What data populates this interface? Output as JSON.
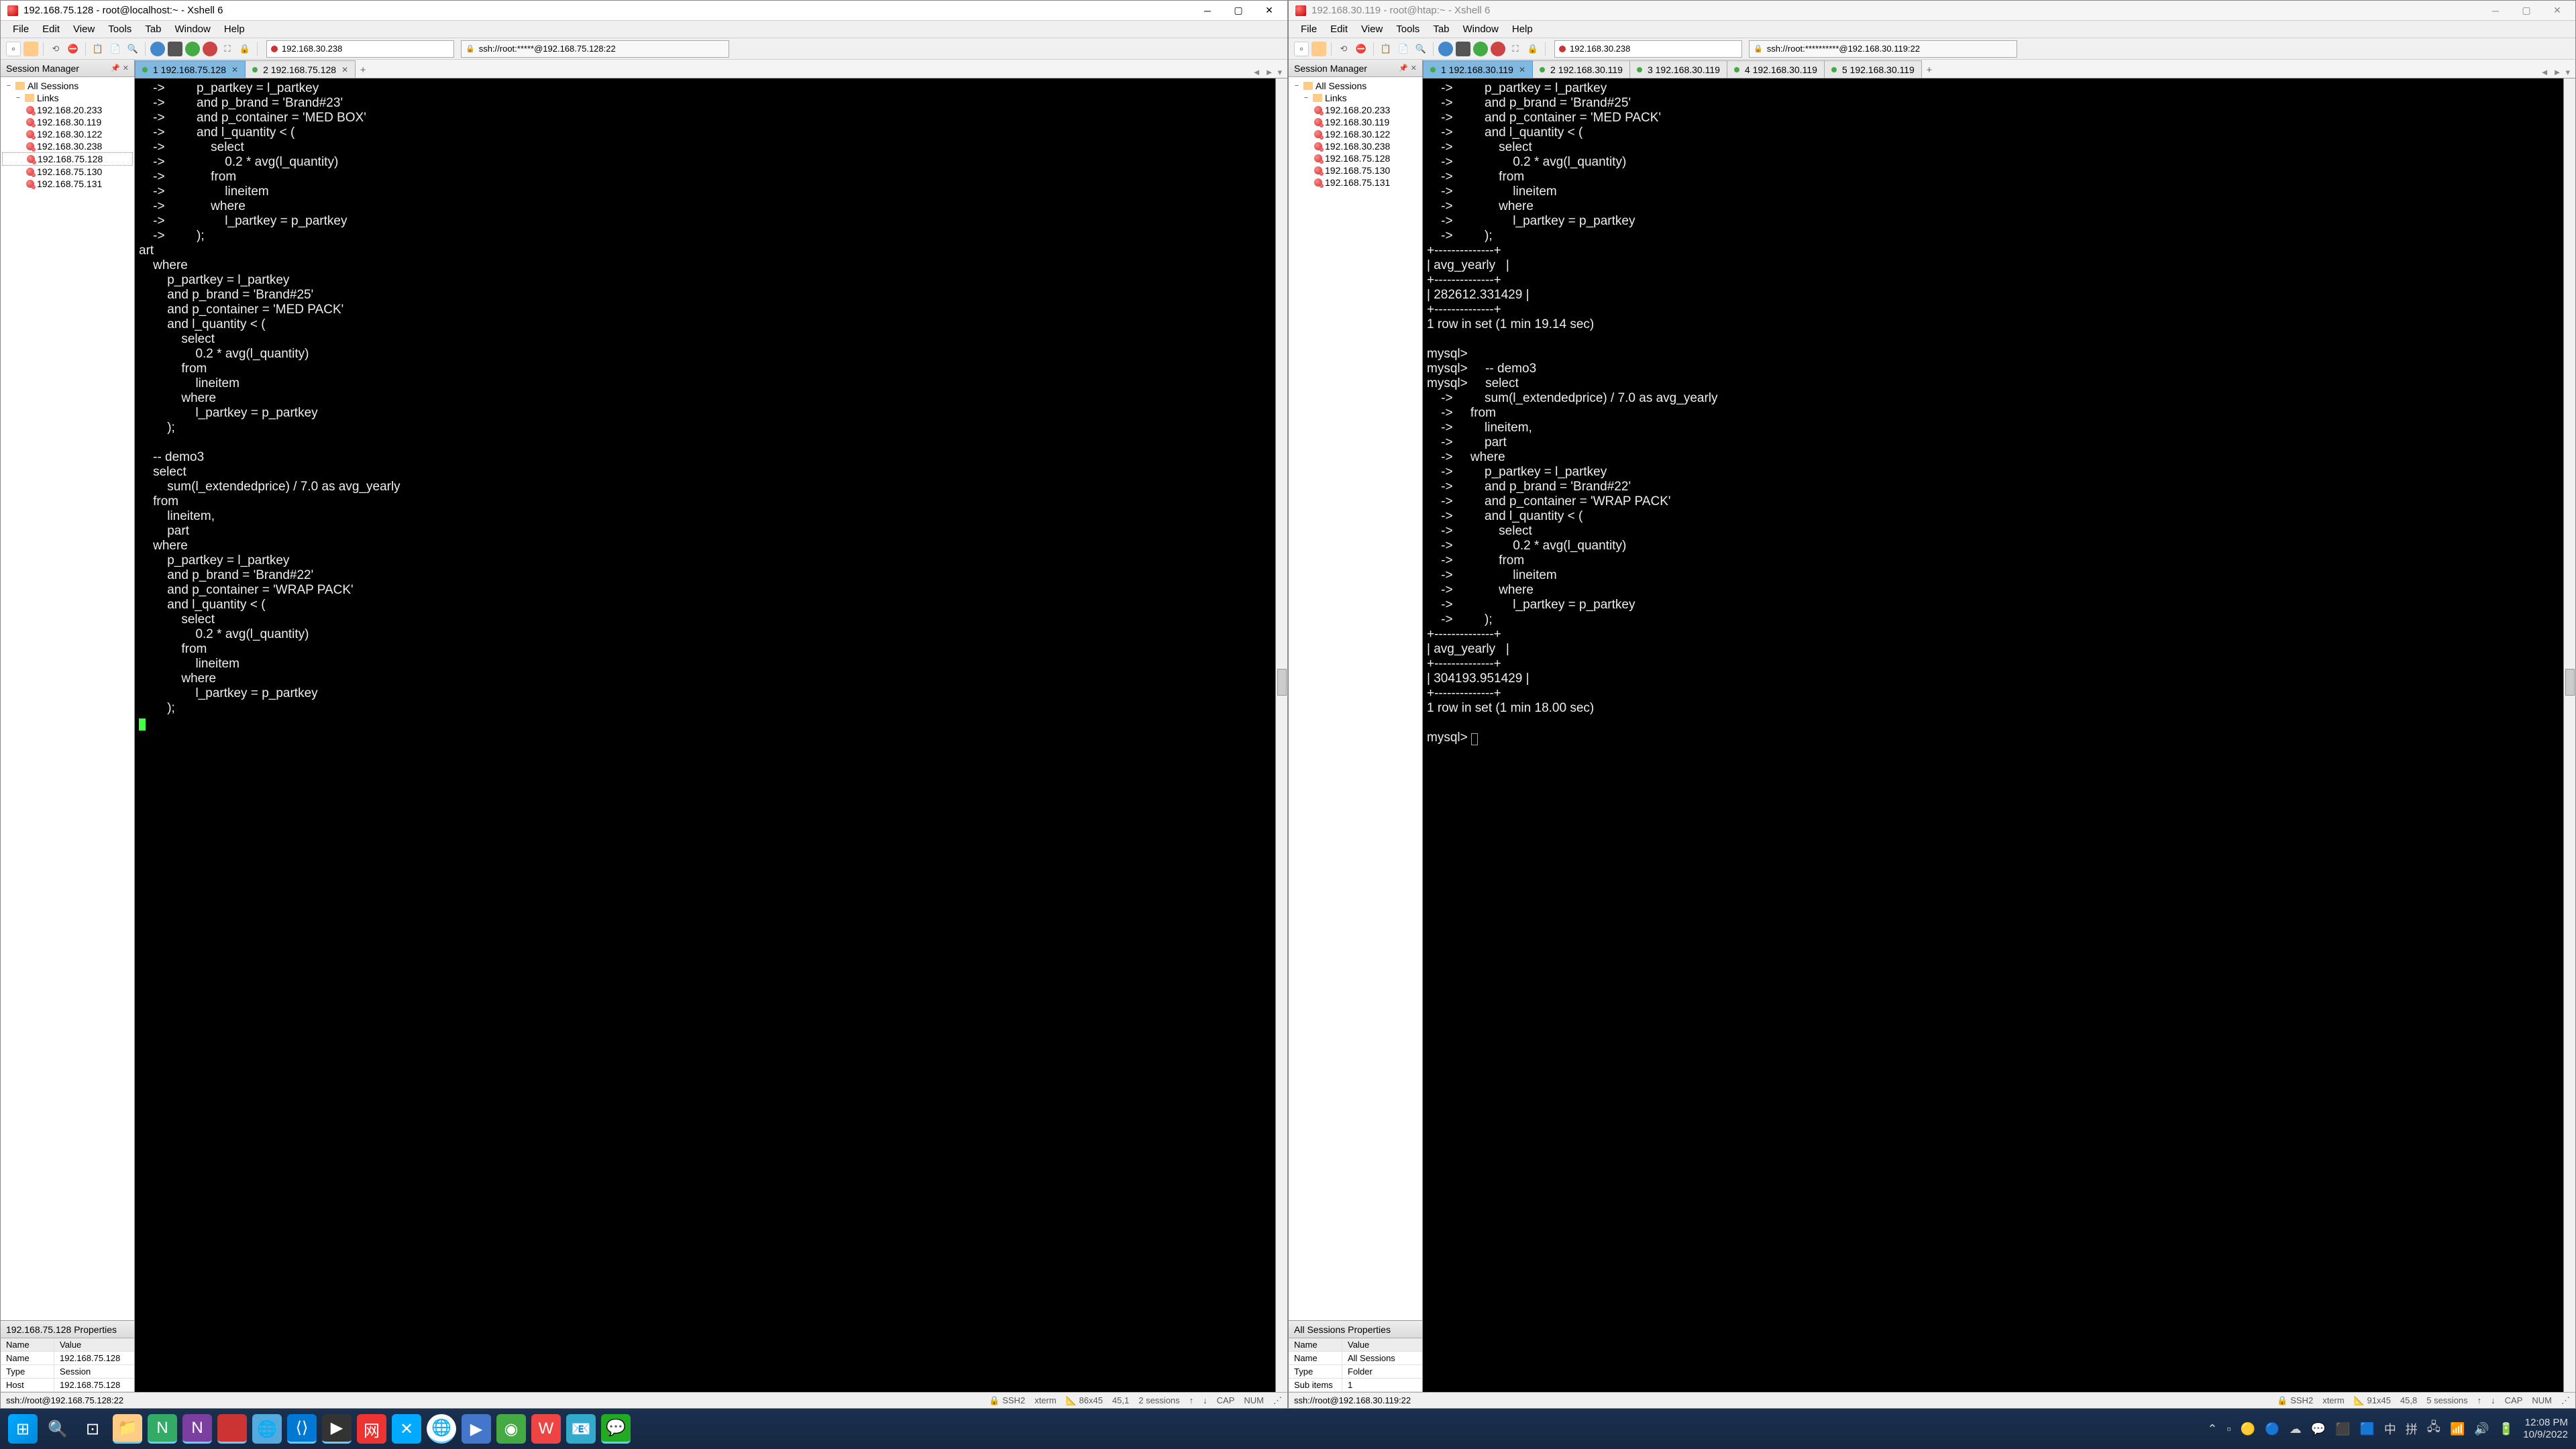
{
  "left": {
    "title": "192.168.75.128 - root@localhost:~ - Xshell 6",
    "menu": [
      "File",
      "Edit",
      "View",
      "Tools",
      "Tab",
      "Window",
      "Help"
    ],
    "addr": "192.168.30.238",
    "ssh_addr": "ssh://root:*****@192.168.75.128:22",
    "session_panel": "Session Manager",
    "tree": {
      "root": "All Sessions",
      "folder": "Links",
      "hosts": [
        "192.168.20.233",
        "192.168.30.119",
        "192.168.30.122",
        "192.168.30.238",
        "192.168.75.128",
        "192.168.75.130",
        "192.168.75.131"
      ],
      "selected": "192.168.75.128"
    },
    "tabs": [
      {
        "label": "1 192.168.75.128",
        "active": true
      },
      {
        "label": "2 192.168.75.128",
        "active": false
      }
    ],
    "terminal": "    ->         p_partkey = l_partkey\n    ->         and p_brand = 'Brand#23'\n    ->         and p_container = 'MED BOX'\n    ->         and l_quantity < (\n    ->             select\n    ->                 0.2 * avg(l_quantity)\n    ->             from\n    ->                 lineitem\n    ->             where\n    ->                 l_partkey = p_partkey\n    ->         );\nart\n    where\n        p_partkey = l_partkey\n        and p_brand = 'Brand#25'\n        and p_container = 'MED PACK'\n        and l_quantity < (\n            select\n                0.2 * avg(l_quantity)\n            from\n                lineitem\n            where\n                l_partkey = p_partkey\n        );\n\n    -- demo3\n    select\n        sum(l_extendedprice) / 7.0 as avg_yearly\n    from\n        lineitem,\n        part\n    where\n        p_partkey = l_partkey\n        and p_brand = 'Brand#22'\n        and p_container = 'WRAP PACK'\n        and l_quantity < (\n            select\n                0.2 * avg(l_quantity)\n            from\n                lineitem\n            where\n                l_partkey = p_partkey\n        );",
    "props_header": "192.168.75.128 Properties",
    "props": [
      {
        "name": "Name",
        "value": "Value"
      },
      {
        "name": "Name",
        "value": "192.168.75.128"
      },
      {
        "name": "Type",
        "value": "Session"
      },
      {
        "name": "Host",
        "value": "192.168.75.128"
      }
    ],
    "status": {
      "conn": "ssh://root@192.168.75.128:22",
      "proto": "SSH2",
      "term": "xterm",
      "size": "86x45",
      "pos": "45,1",
      "sess": "2 sessions",
      "caps": "CAP",
      "num": "NUM"
    }
  },
  "right": {
    "title": "192.168.30.119 - root@htap:~ - Xshell 6",
    "menu": [
      "File",
      "Edit",
      "View",
      "Tools",
      "Tab",
      "Window",
      "Help"
    ],
    "addr": "192.168.30.238",
    "ssh_addr": "ssh://root:**********@192.168.30.119:22",
    "session_panel": "Session Manager",
    "tree": {
      "root": "All Sessions",
      "folder": "Links",
      "hosts": [
        "192.168.20.233",
        "192.168.30.119",
        "192.168.30.122",
        "192.168.30.238",
        "192.168.75.128",
        "192.168.75.130",
        "192.168.75.131"
      ]
    },
    "tabs": [
      {
        "label": "1 192.168.30.119",
        "active": true
      },
      {
        "label": "2 192.168.30.119",
        "active": false
      },
      {
        "label": "3 192.168.30.119",
        "active": false
      },
      {
        "label": "4 192.168.30.119",
        "active": false
      },
      {
        "label": "5 192.168.30.119",
        "active": false
      }
    ],
    "terminal": "    ->         p_partkey = l_partkey\n    ->         and p_brand = 'Brand#25'\n    ->         and p_container = 'MED PACK'\n    ->         and l_quantity < (\n    ->             select\n    ->                 0.2 * avg(l_quantity)\n    ->             from\n    ->                 lineitem\n    ->             where\n    ->                 l_partkey = p_partkey\n    ->         );\n+--------------+\n| avg_yearly   |\n+--------------+\n| 282612.331429 |\n+--------------+\n1 row in set (1 min 19.14 sec)\n\nmysql>\nmysql>     -- demo3\nmysql>     select\n    ->         sum(l_extendedprice) / 7.0 as avg_yearly\n    ->     from\n    ->         lineitem,\n    ->         part\n    ->     where\n    ->         p_partkey = l_partkey\n    ->         and p_brand = 'Brand#22'\n    ->         and p_container = 'WRAP PACK'\n    ->         and l_quantity < (\n    ->             select\n    ->                 0.2 * avg(l_quantity)\n    ->             from\n    ->                 lineitem\n    ->             where\n    ->                 l_partkey = p_partkey\n    ->         );\n+--------------+\n| avg_yearly   |\n+--------------+\n| 304193.951429 |\n+--------------+\n1 row in set (1 min 18.00 sec)\n\nmysql> ",
    "props_header": "All Sessions Properties",
    "props": [
      {
        "name": "Name",
        "value": "Value"
      },
      {
        "name": "Name",
        "value": "All Sessions"
      },
      {
        "name": "Type",
        "value": "Folder"
      },
      {
        "name": "Sub items",
        "value": "1"
      }
    ],
    "status": {
      "conn": "ssh://root@192.168.30.119:22",
      "proto": "SSH2",
      "term": "xterm",
      "size": "91x45",
      "pos": "45,8",
      "sess": "5 sessions",
      "caps": "CAP",
      "num": "NUM"
    }
  },
  "taskbar": {
    "clock_time": "12:08 PM",
    "clock_date": "10/9/2022",
    "ime": "拼"
  }
}
